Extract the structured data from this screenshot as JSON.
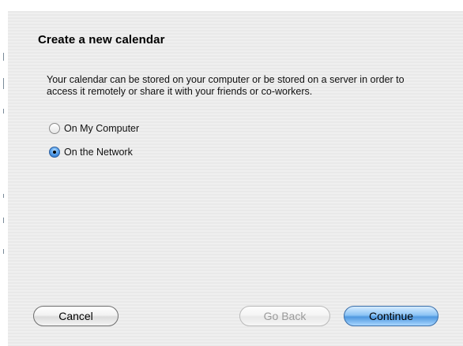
{
  "dialog": {
    "title": "Create a new calendar",
    "description": "Your calendar can be stored on your computer or be stored on a server in order to access it remotely or share it with your friends or co-workers.",
    "options": [
      {
        "label": "On My Computer",
        "checked": false
      },
      {
        "label": "On the Network",
        "checked": true
      }
    ],
    "buttons": {
      "cancel": "Cancel",
      "go_back": "Go Back",
      "continue": "Continue"
    }
  },
  "colors": {
    "background": "#ededed",
    "accent": "#4f98e0",
    "disabled_text": "#9a9a9a"
  }
}
